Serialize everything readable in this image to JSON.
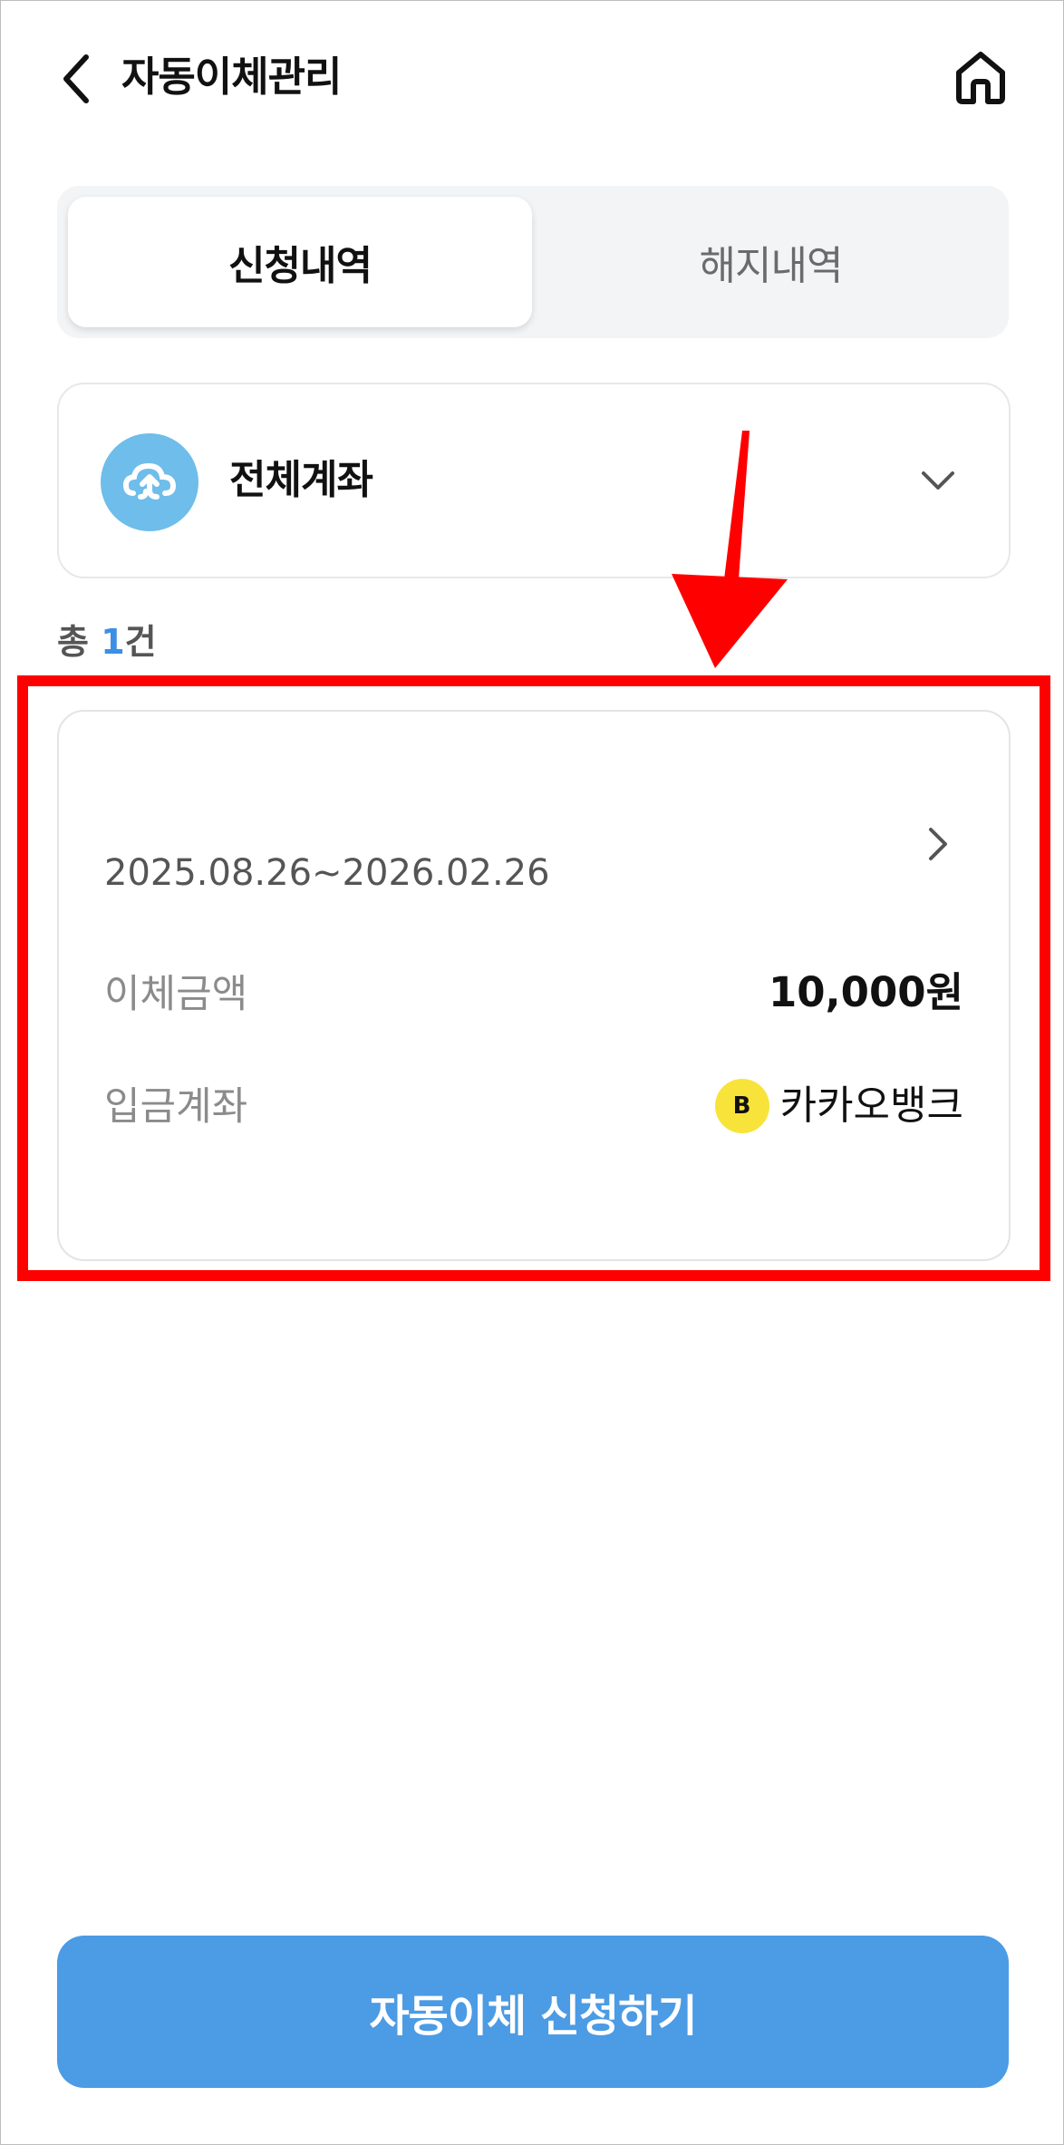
{
  "header": {
    "title": "자동이체관리",
    "back_icon": "chevron-left-icon",
    "home_icon": "home-icon"
  },
  "tabs": [
    {
      "label": "신청내역",
      "active": true
    },
    {
      "label": "해지내역",
      "active": false
    }
  ],
  "account_selector": {
    "label": "전체계좌",
    "icon": "cloud-swap-icon",
    "icon_color": "#6ebdea"
  },
  "count": {
    "prefix": "총",
    "number": "1",
    "suffix": "건"
  },
  "transfers": [
    {
      "period": "2025.08.26~2026.02.26",
      "amount_label": "이체금액",
      "amount": "10,000원",
      "account_label": "입금계좌",
      "bank_logo_letter": "B",
      "bank_name": "카카오뱅크"
    }
  ],
  "annotation": {
    "color": "#ff0000"
  },
  "footer": {
    "apply_label": "자동이체 신청하기",
    "apply_color": "#4b9be5"
  }
}
